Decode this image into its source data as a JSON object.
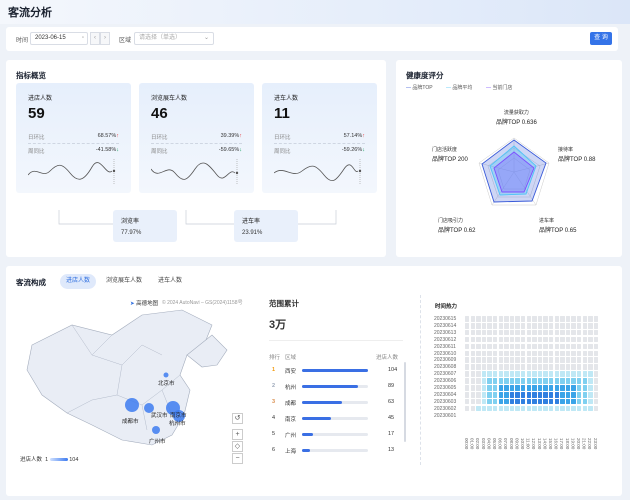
{
  "header": {
    "title": "客流分析"
  },
  "filter": {
    "date_label": "时间",
    "date": "2023-06-15",
    "prev": "‹",
    "next": "›",
    "area_label": "区域",
    "area_placeholder": "请选择（单选）",
    "query": "查 询"
  },
  "overview": {
    "title": "指标概览",
    "kpis": [
      {
        "name": "进店人数",
        "value": "59",
        "mom_label": "日环比",
        "mom": "68.57%",
        "mom_dir": "↑",
        "wow_label": "周同比",
        "wow": "-41.58%",
        "wow_dir": "↓"
      },
      {
        "name": "浏览展车人数",
        "value": "46",
        "mom_label": "日环比",
        "mom": "39.39%",
        "mom_dir": "↑",
        "wow_label": "周同比",
        "wow": "-59.65%",
        "wow_dir": "↓"
      },
      {
        "name": "进车人数",
        "value": "11",
        "mom_label": "日环比",
        "mom": "57.14%",
        "mom_dir": "↑",
        "wow_label": "周同比",
        "wow": "-59.26%",
        "wow_dir": "↓"
      }
    ],
    "rates": [
      {
        "name": "浏览率",
        "value": "77.97%"
      },
      {
        "name": "进车率",
        "value": "23.91%"
      }
    ]
  },
  "health": {
    "title": "健康度评分",
    "legend": [
      "品牌TOP",
      "品牌平均",
      "当前门店"
    ],
    "axes": [
      {
        "name": "流量获取力",
        "sub": "品牌TOP 0.636"
      },
      {
        "name": "接待率",
        "sub": "品牌TOP 0.88"
      },
      {
        "name": "进车率",
        "sub": "品牌TOP 0.65"
      },
      {
        "name": "门店吸引力",
        "sub": "品牌TOP 0.62"
      },
      {
        "name": "门店活跃度",
        "sub": "品牌TOP 200"
      }
    ],
    "colors": {
      "top": "#3a5bd9",
      "avg": "#4fc3f7",
      "store": "#7c4dff"
    }
  },
  "composition": {
    "title": "客流构成",
    "tabs": [
      "进店人数",
      "浏览展车人数",
      "进车人数"
    ],
    "map": {
      "attribution": "高德地图",
      "copyright": "© 2024 AutoNavi – GS(2024)1158号",
      "cities": [
        "北京市",
        "武汉市",
        "南京市",
        "杭州市",
        "成都市",
        "广州市"
      ],
      "legend_label": "进店人数",
      "legend_min": "1",
      "legend_max": "104"
    },
    "range": {
      "title": "范围累计",
      "value": "3万"
    },
    "ranking": {
      "headers": [
        "排行",
        "区域",
        "进店人数"
      ],
      "rows": [
        {
          "rank": "1",
          "city": "西安",
          "value": 104,
          "label": "104"
        },
        {
          "rank": "2",
          "city": "杭州",
          "value": 89,
          "label": "89"
        },
        {
          "rank": "3",
          "city": "成都",
          "value": 63,
          "label": "63"
        },
        {
          "rank": "4",
          "city": "南京",
          "value": 45,
          "label": "45"
        },
        {
          "rank": "5",
          "city": "广州",
          "value": 17,
          "label": "17"
        },
        {
          "rank": "6",
          "city": "上海",
          "value": 13,
          "label": "13"
        }
      ]
    },
    "heatmap": {
      "title": "时间热力",
      "dates": [
        "20230615",
        "20230614",
        "20230613",
        "20230612",
        "20230611",
        "20230610",
        "20230609",
        "20230608",
        "20230607",
        "20230606",
        "20230605",
        "20230604",
        "20230603",
        "20230602",
        "20230601"
      ],
      "hours": [
        "00:00",
        "01:00",
        "02:00",
        "03:00",
        "04:00",
        "05:00",
        "06:00",
        "07:00",
        "08:00",
        "09:00",
        "10:00",
        "11:00",
        "12:00",
        "13:00",
        "14:00",
        "15:00",
        "16:00",
        "17:00",
        "18:00",
        "19:00",
        "20:00",
        "21:00",
        "22:00",
        "23:00"
      ],
      "colors": {
        "empty": "#e4e6ea",
        "low": "#bfe8f5",
        "mid": "#7fd0f0",
        "high": "#3aa4e8",
        "max": "#2f7fe0"
      }
    }
  }
}
